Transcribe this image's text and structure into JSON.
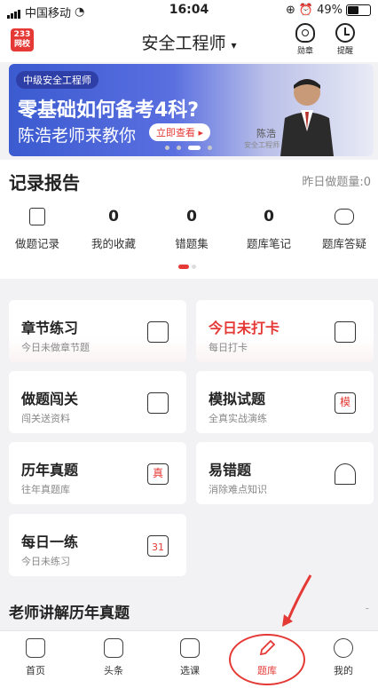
{
  "status_bar": {
    "carrier": "中国移动",
    "time": "16:04",
    "battery": "49%"
  },
  "header": {
    "logo_line1": "233",
    "logo_line2": "网校",
    "title": "安全工程师",
    "medal_label": "勋章",
    "remind_label": "提醒"
  },
  "banner": {
    "badge": "中级安全工程师",
    "headline": "零基础如何备考4科?",
    "subline": "陈浩老师来教你",
    "cta": "立即查看",
    "teacher_name": "陈浩",
    "teacher_role": "安全工程师"
  },
  "records": {
    "title": "记录报告",
    "yesterday": "昨日做题量:0",
    "items": [
      {
        "value": "",
        "label": "做题记录"
      },
      {
        "value": "0",
        "label": "我的收藏"
      },
      {
        "value": "0",
        "label": "错题集"
      },
      {
        "value": "0",
        "label": "题库笔记"
      },
      {
        "value": "",
        "label": "题库答疑"
      }
    ]
  },
  "cards": [
    {
      "title": "章节练习",
      "sub": "今日未做章节题"
    },
    {
      "title": "今日未打卡",
      "sub": "每日打卡"
    },
    {
      "title": "做题闯关",
      "sub": "闯关送资料"
    },
    {
      "title": "模拟试题",
      "sub": "全真实战演练",
      "icon_text": "模"
    },
    {
      "title": "历年真题",
      "sub": "往年真题库",
      "icon_text": "真"
    },
    {
      "title": "易错题",
      "sub": "消除难点知识"
    },
    {
      "title": "每日一练",
      "sub": "今日未练习",
      "icon_text": "31"
    }
  ],
  "teacher_section": {
    "title": "老师讲解历年真题",
    "more": "-"
  },
  "tabbar": [
    {
      "label": "首页"
    },
    {
      "label": "头条"
    },
    {
      "label": "选课"
    },
    {
      "label": "题库"
    },
    {
      "label": "我的"
    }
  ],
  "colors": {
    "accent": "#e53935",
    "banner_blue": "#3b5bd0"
  }
}
